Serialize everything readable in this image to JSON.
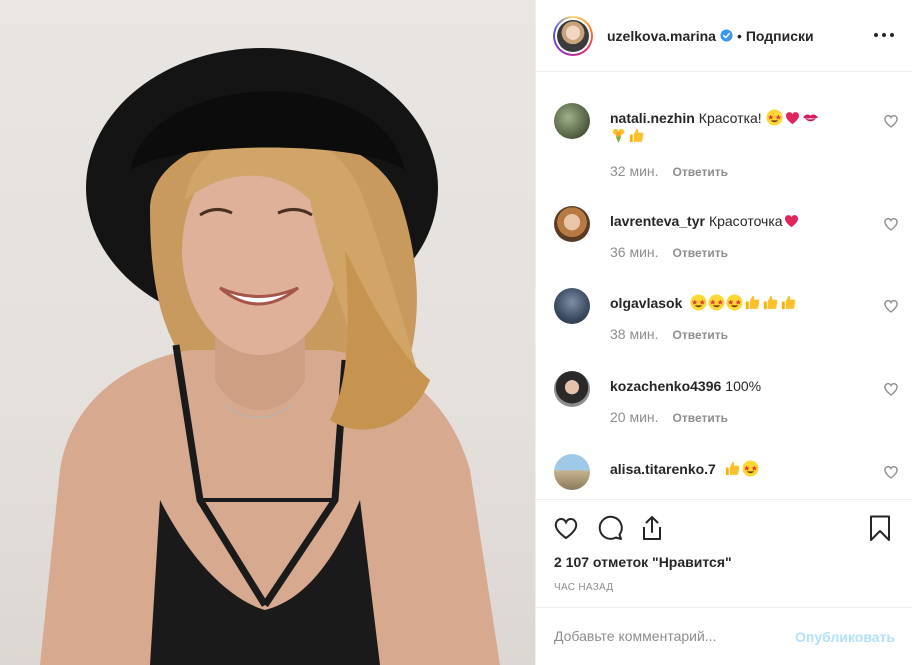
{
  "post": {
    "author": {
      "username": "uzelkova.marina",
      "verified": true,
      "separator": "•",
      "follow_label": "Подписки"
    },
    "comments": [
      {
        "username": "natali.nezhin",
        "text": "Красотка!",
        "emojis": [
          "star-struck",
          "red-heart",
          "kiss-mark",
          "bouquet",
          "thumbs-up"
        ],
        "time": "32 мин.",
        "reply_label": "Ответить"
      },
      {
        "username": "lavrenteva_tyr",
        "text": "Красоточка",
        "emojis": [
          "red-heart"
        ],
        "time": "36 мин.",
        "reply_label": "Ответить"
      },
      {
        "username": "olgavlasok",
        "text": "",
        "emojis": [
          "star-struck",
          "star-struck",
          "star-struck",
          "thumbs-up",
          "thumbs-up",
          "thumbs-up"
        ],
        "time": "38 мин.",
        "reply_label": "Ответить"
      },
      {
        "username": "kozachenko4396",
        "text": "100%",
        "emojis": [],
        "time": "20 мин.",
        "reply_label": "Ответить"
      },
      {
        "username": "alisa.titarenko.7",
        "text": "",
        "emojis": [
          "thumbs-up",
          "star-struck"
        ],
        "time": "",
        "reply_label": ""
      }
    ],
    "likes_text": "2 107 отметок \"Нравится\"",
    "posted_time": "ЧАС НАЗАД",
    "add_comment_placeholder": "Добавьте комментарий...",
    "publish_label": "Опубликовать"
  },
  "icons": {
    "more": "more-options-icon",
    "like": "heart-icon",
    "comment": "comment-bubble-icon",
    "share": "share-icon",
    "save": "bookmark-icon",
    "comment_like": "small-heart-icon",
    "verified": "verified-badge-icon"
  },
  "colors": {
    "text": "#262626",
    "secondary": "#8e8e8e",
    "verified": "#3897f0",
    "publish_disabled": "#b2dffc",
    "border": "#efefef"
  }
}
